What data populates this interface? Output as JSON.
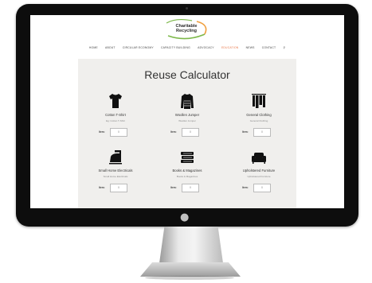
{
  "site": {
    "logo": {
      "line1": "Charitable",
      "line2": "Recycling"
    },
    "nav": [
      {
        "label": "HOME",
        "active": false
      },
      {
        "label": "ABOUT",
        "active": false
      },
      {
        "label": "CIRCULAR ECONOMY",
        "active": false
      },
      {
        "label": "CAPACITY BUILDING",
        "active": false
      },
      {
        "label": "ADVOCACY",
        "active": false
      },
      {
        "label": "EDUCATION",
        "active": true
      },
      {
        "label": "NEWS",
        "active": false
      },
      {
        "label": "CONTACT",
        "active": false
      }
    ]
  },
  "calculator": {
    "title": "Reuse Calculator",
    "items": [
      {
        "name": "Cotton T-Shirt",
        "sub": "Eg: Cotton T-Shirt",
        "qty_label": "Item:",
        "value": "0",
        "icon": "tshirt-icon"
      },
      {
        "name": "Woollen Jumper",
        "sub": "Woollen Jumper",
        "qty_label": "Item:",
        "value": "0",
        "icon": "jumper-icon"
      },
      {
        "name": "General Clothing",
        "sub": "General Clothing",
        "qty_label": "Item:",
        "value": "0",
        "icon": "clothing-rack-icon"
      },
      {
        "name": "Small Home Electricals",
        "sub": "Small Home Electricals",
        "qty_label": "Item:",
        "value": "0",
        "icon": "iron-icon"
      },
      {
        "name": "Books & Magazines",
        "sub": "Books & Magazines",
        "qty_label": "Item:",
        "value": "0",
        "icon": "books-icon"
      },
      {
        "name": "Upholstered Furniture",
        "sub": "Upholstered Furniture",
        "qty_label": "Item:",
        "value": "0",
        "icon": "sofa-icon"
      }
    ]
  },
  "colors": {
    "accent": "#e9784a",
    "logo_green": "#7db84a",
    "logo_orange": "#f0a040",
    "panel": "#f0efed",
    "bezel": "#0d0d0d"
  }
}
